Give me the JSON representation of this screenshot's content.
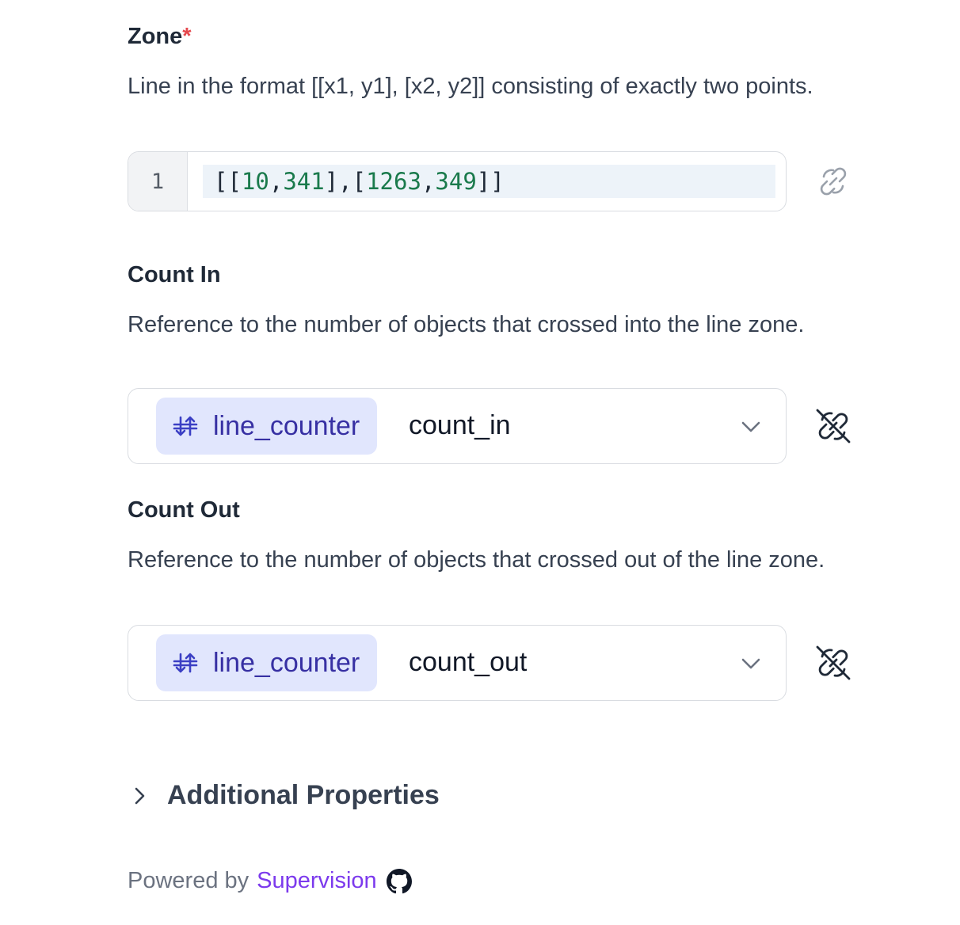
{
  "zone": {
    "title": "Zone",
    "required_mark": "*",
    "description": "Line in the format [[x1, y1], [x2, y2]] consisting of exactly two points.",
    "editor": {
      "line_number": "1",
      "code": {
        "open": "[[",
        "x1": "10",
        "y1": "341",
        "mid": "],[",
        "x2": "1263",
        "y2": "349",
        "close": "]]",
        "sep": ","
      }
    },
    "link_icon": "link-icon"
  },
  "count_in": {
    "title": "Count In",
    "description": "Reference to the number of objects that crossed into the line zone.",
    "step_chip": "line_counter",
    "selected_output": "count_in",
    "unlink_icon": "unlink-icon"
  },
  "count_out": {
    "title": "Count Out",
    "description": "Reference to the number of objects that crossed out of the line zone.",
    "step_chip": "line_counter",
    "selected_output": "count_out",
    "unlink_icon": "unlink-icon"
  },
  "additional_properties": {
    "label": "Additional Properties"
  },
  "footer": {
    "prefix": "Powered by",
    "brand": "Supervision",
    "brand_color": "#7c3aed",
    "icon": "github-icon"
  },
  "colors": {
    "chip_bg": "#e1e6fd",
    "chip_text": "#3730a3",
    "required": "#e5484d",
    "code_number": "#1a7a4c"
  }
}
